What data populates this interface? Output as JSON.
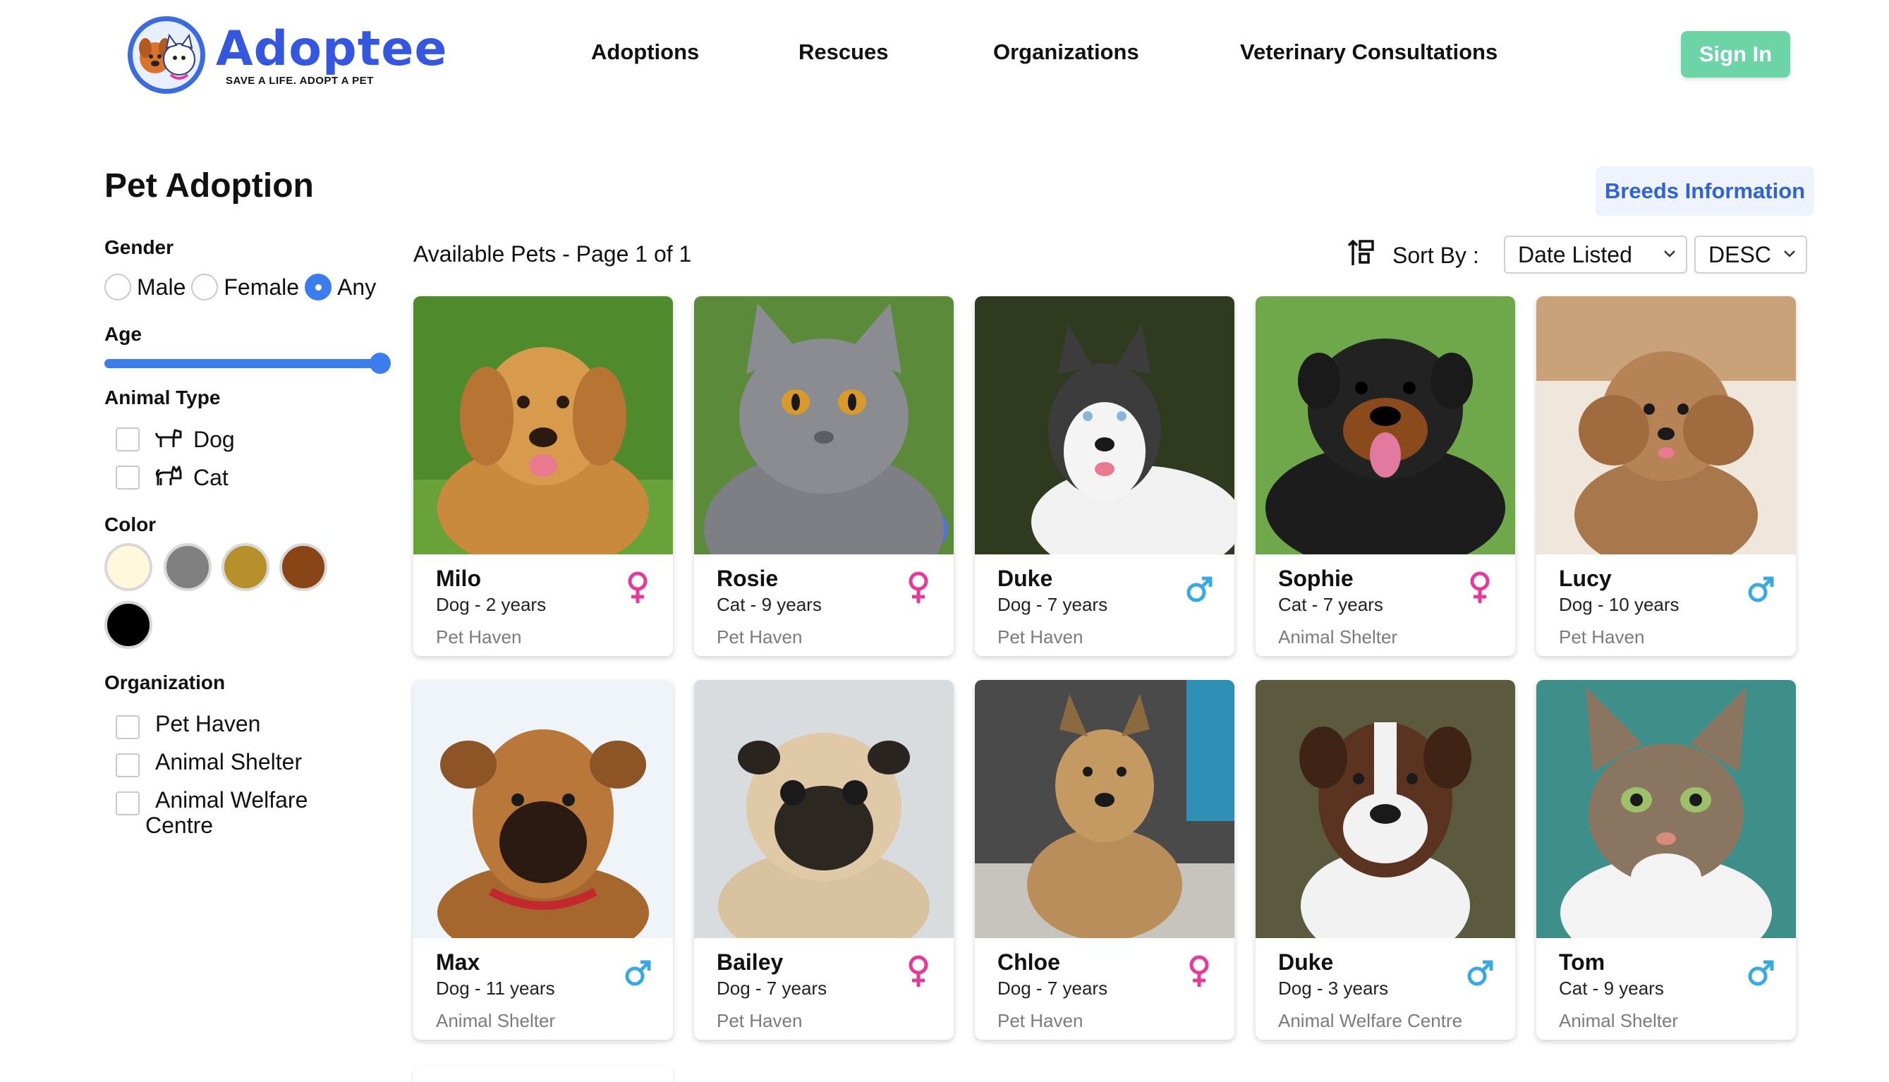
{
  "brand": {
    "name": "Adoptee",
    "tagline": "SAVE A LIFE.  ADOPT A PET"
  },
  "nav": {
    "items": [
      "Adoptions",
      "Rescues",
      "Organizations",
      "Veterinary Consultations"
    ],
    "signin_label": "Sign In"
  },
  "page": {
    "title": "Pet Adoption",
    "breeds_button": "Breeds Information"
  },
  "filters": {
    "gender": {
      "title": "Gender",
      "options": [
        "Male",
        "Female",
        "Any"
      ],
      "selected": "Any"
    },
    "age": {
      "title": "Age",
      "value_fraction": 1.0
    },
    "animal_type": {
      "title": "Animal Type",
      "options": [
        {
          "label": "Dog",
          "icon": "dog-icon"
        },
        {
          "label": "Cat",
          "icon": "cat-icon"
        }
      ]
    },
    "color": {
      "title": "Color",
      "swatches": [
        "#fff8dc",
        "#808080",
        "#b8902b",
        "#8a4517",
        "#000000"
      ]
    },
    "organization": {
      "title": "Organization",
      "options": [
        "Pet Haven",
        "Animal Shelter",
        "Animal Welfare",
        "Centre"
      ]
    }
  },
  "listing": {
    "summary": "Available Pets - Page 1 of 1",
    "sort_label": "Sort By :",
    "sort_field": "Date Listed",
    "sort_order": "DESC"
  },
  "pets": [
    {
      "name": "Milo",
      "sub": "Dog - 2 years",
      "org": "Pet Haven",
      "gender": "female"
    },
    {
      "name": "Rosie",
      "sub": "Cat - 9 years",
      "org": "Pet Haven",
      "gender": "female"
    },
    {
      "name": "Duke",
      "sub": "Dog - 7 years",
      "org": "Pet Haven",
      "gender": "male"
    },
    {
      "name": "Sophie",
      "sub": "Cat - 7 years",
      "org": "Animal Shelter",
      "gender": "female"
    },
    {
      "name": "Lucy",
      "sub": "Dog - 10 years",
      "org": "Pet Haven",
      "gender": "male"
    },
    {
      "name": "Max",
      "sub": "Dog - 11 years",
      "org": "Animal Shelter",
      "gender": "male"
    },
    {
      "name": "Bailey",
      "sub": "Dog - 7 years",
      "org": "Pet Haven",
      "gender": "female"
    },
    {
      "name": "Chloe",
      "sub": "Dog - 7 years",
      "org": "Pet Haven",
      "gender": "female"
    },
    {
      "name": "Duke",
      "sub": "Dog - 3 years",
      "org": "Animal Welfare Centre",
      "gender": "male"
    },
    {
      "name": "Tom",
      "sub": "Cat - 9 years",
      "org": "Animal Shelter",
      "gender": "male"
    }
  ],
  "colors": {
    "brand": "#3557e0",
    "accent": "#3b7dec",
    "signin": "#6dd4a8",
    "female": "#e8389a",
    "male": "#39a9e5"
  }
}
